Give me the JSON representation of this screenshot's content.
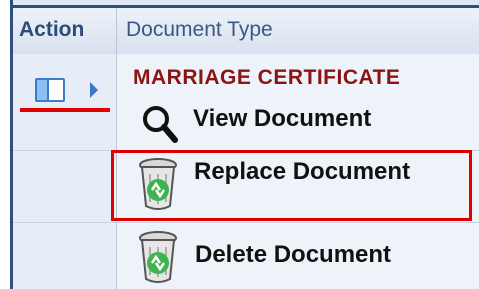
{
  "header": {
    "action_label": "Action",
    "document_type_label": "Document Type"
  },
  "document": {
    "title": "MARRIAGE CERTIFICATE"
  },
  "menu": {
    "items": [
      {
        "label": "View Document",
        "icon": "magnifier-icon"
      },
      {
        "label": "Replace Document",
        "icon": "recycle-bin-icon"
      },
      {
        "label": "Delete Document",
        "icon": "recycle-bin-icon"
      }
    ]
  },
  "colors": {
    "header_text": "#2d4b75",
    "title_text": "#8a1313",
    "highlight": "#e00000",
    "accent": "#3d7bd1"
  }
}
